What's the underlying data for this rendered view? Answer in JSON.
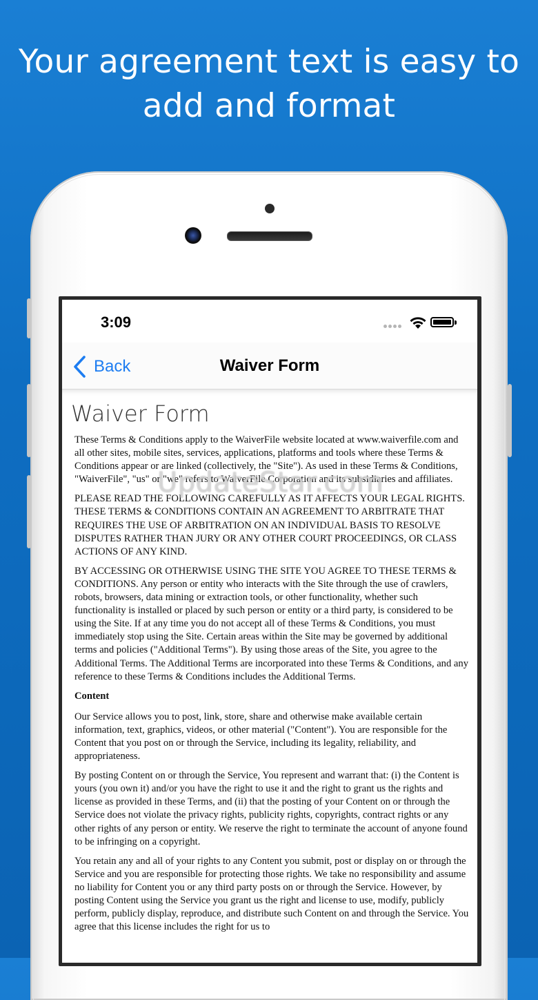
{
  "headline": {
    "line1": "Your agreement text is easy to",
    "line2": "add and format"
  },
  "status_bar": {
    "time": "3:09"
  },
  "nav": {
    "back_label": "Back",
    "title": "Waiver Form"
  },
  "document": {
    "title": "Waiver Form",
    "paragraphs": [
      "These Terms & Conditions apply to the WaiverFile website located at www.waiverfile.com and all other sites, mobile sites, services, applications, platforms and tools where these Terms & Conditions appear or are linked (collectively, the \"Site\"). As used in these Terms & Conditions, \"WaiverFile\", \"us\" or \"we\" refers to WaiverFile Corporation and its subsidiaries and affiliates.",
      "PLEASE READ THE FOLLOWING CAREFULLY AS IT AFFECTS YOUR LEGAL RIGHTS. THESE TERMS & CONDITIONS CONTAIN AN AGREEMENT TO ARBITRATE THAT REQUIRES THE USE OF ARBITRATION ON AN INDIVIDUAL BASIS TO RESOLVE DISPUTES RATHER THAN JURY OR ANY OTHER COURT PROCEEDINGS, OR CLASS ACTIONS OF ANY KIND.",
      "BY ACCESSING OR OTHERWISE USING THE SITE YOU AGREE TO THESE TERMS & CONDITIONS. Any person or entity who interacts with the Site through the use of crawlers, robots, browsers, data mining or extraction tools, or other functionality, whether such functionality is installed or placed by such person or entity or a third party, is considered to be using the Site. If at any time you do not accept all of these Terms & Conditions, you must immediately stop using the Site. Certain areas within the Site may be governed by additional terms and policies (\"Additional Terms\"). By using those areas of the Site, you agree to the Additional Terms. The Additional Terms are incorporated into these Terms & Conditions, and any reference to these Terms & Conditions includes the Additional Terms."
    ],
    "section_heading": "Content",
    "section_paragraphs": [
      "Our Service allows you to post, link, store, share and otherwise make available certain information, text, graphics, videos, or other material (\"Content\"). You are responsible for the Content that you post on or through the Service, including its legality, reliability, and appropriateness.",
      "By posting Content on or through the Service, You represent and warrant that: (i) the Content is yours (you own it) and/or you have the right to use it and the right to grant us the rights and license as provided in these Terms, and (ii) that the posting of your Content on or through the Service does not violate the privacy rights, publicity rights, copyrights, contract rights or any other rights of any person or entity. We reserve the right to terminate the account of anyone found to be infringing on a copyright.",
      "You retain any and all of your rights to any Content you submit, post or display on or through the Service and you are responsible for protecting those rights. We take no responsibility and assume no liability for Content you or any third party posts on or through the Service. However, by posting Content using the Service you grant us the right and license to use, modify, publicly perform, publicly display, reproduce, and distribute such Content on and through the Service. You agree that this license includes the right for us to"
    ]
  },
  "watermark": "UpdateStar.com",
  "colors": {
    "background": "#0e6ec2",
    "link": "#1d7df1"
  }
}
